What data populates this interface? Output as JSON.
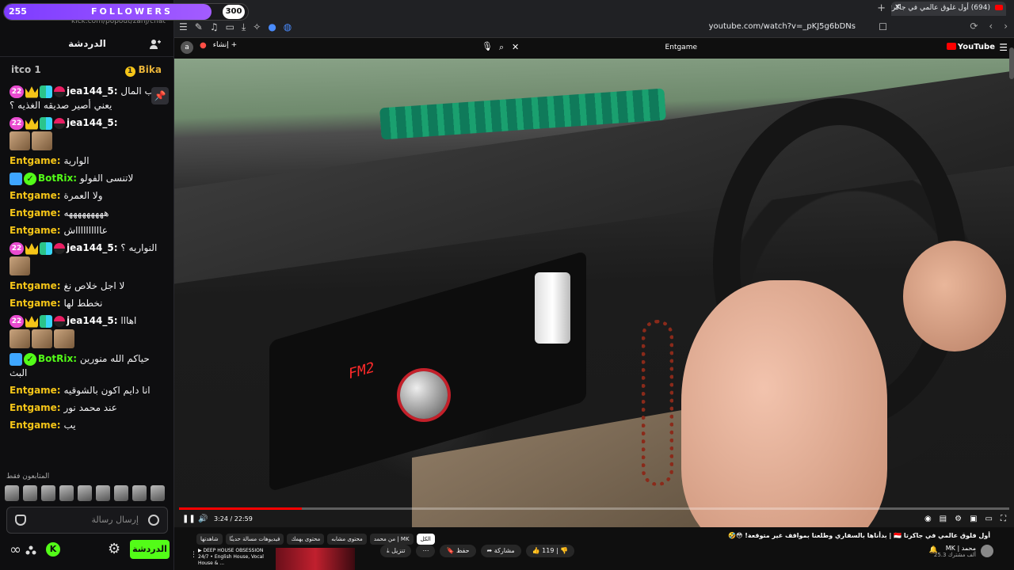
{
  "followers": {
    "current": "255",
    "label": "FOLLOWERS",
    "goal": "300",
    "progress_fraction": 0.85
  },
  "kick_url": "kick.com/popout/zanj/chat",
  "chat": {
    "title": "الدردشة",
    "top_left": "itco 1",
    "top_right": "Bika",
    "messages": [
      {
        "name": "jea144_5:",
        "name_color": "#ffffff",
        "badges": [
          "sub22",
          "crown",
          "grid",
          "pokeball"
        ],
        "text": "ب المال يعني أصير صديقه الغذيه ؟",
        "emotes": 0
      },
      {
        "name": "jea144_5:",
        "name_color": "#ffffff",
        "badges": [
          "sub22",
          "crown",
          "grid",
          "pokeball"
        ],
        "text": "",
        "emotes": 2
      },
      {
        "name": "Entgame:",
        "name_color": "#f5c518",
        "badges": [],
        "text": "الوارية",
        "emotes": 0
      },
      {
        "name": "BotRix:",
        "name_color": "#53fc18",
        "badges": [
          "bot",
          "verified"
        ],
        "text": "لاتنسى الفولو",
        "emotes": 0
      },
      {
        "name": "Entgame:",
        "name_color": "#f5c518",
        "badges": [],
        "text": "ولا العمرة",
        "emotes": 0
      },
      {
        "name": "Entgame:",
        "name_color": "#f5c518",
        "badges": [],
        "text": "هههههههههه",
        "emotes": 0
      },
      {
        "name": "Entgame:",
        "name_color": "#f5c518",
        "badges": [],
        "text": "عااااااااااش",
        "emotes": 0
      },
      {
        "name": "jea144_5:",
        "name_color": "#ffffff",
        "badges": [
          "sub22",
          "crown",
          "grid",
          "pokeball"
        ],
        "text": "النواريه ؟",
        "emotes": 1
      },
      {
        "name": "Entgame:",
        "name_color": "#f5c518",
        "badges": [],
        "text": "لا اجل خلاص نغ",
        "emotes": 0
      },
      {
        "name": "Entgame:",
        "name_color": "#f5c518",
        "badges": [],
        "text": "نخطط لها",
        "emotes": 0
      },
      {
        "name": "jea144_5:",
        "name_color": "#ffffff",
        "badges": [
          "sub22",
          "crown",
          "grid",
          "pokeball"
        ],
        "text": "اهااا",
        "emotes": 3
      },
      {
        "name": "BotRix:",
        "name_color": "#53fc18",
        "badges": [
          "bot",
          "verified"
        ],
        "text": "حياكم الله منورين البث",
        "emotes": 0
      },
      {
        "name": "Entgame:",
        "name_color": "#f5c518",
        "badges": [],
        "text": "انا دايم اكون بالشوقيه",
        "emotes": 0
      },
      {
        "name": "Entgame:",
        "name_color": "#f5c518",
        "badges": [],
        "text": "عند محمد نور",
        "emotes": 0
      },
      {
        "name": "Entgame:",
        "name_color": "#f5c518",
        "badges": [],
        "text": "يب",
        "emotes": 0
      }
    ],
    "followers_only": "المتابعون فقط",
    "input_placeholder": "إرسال رسالة",
    "send_label": "الدردشة"
  },
  "browser": {
    "tab_title": "(694) أول غلوق عالمي في جاكرتا",
    "url": "youtube.com/watch?v=_pKJ5g6bDNs",
    "search_query": "Entgame",
    "youtube_label": "YouTube",
    "create_label": "إنشاء"
  },
  "player": {
    "time": "3:24 / 22:59",
    "progress_fraction": 0.148
  },
  "video_info": {
    "title": "أول فلوق عالمي في جاكرتا 🇮🇩 | بدأناها بالسفاري وطلعنا بمواقف غير متوقعة! 😳🤣",
    "channel": "MK | محمد",
    "subs": "25.3 ألف مشترك",
    "likes": "119",
    "share": "مشاركة",
    "download": "تنزيل",
    "save": "حفظ",
    "chips": [
      "الكل",
      "من محمد | MK",
      "محتوى مشابه",
      "محتوى يهمك",
      "فيديوهات مسالة حديثًا",
      "شاهدتها"
    ],
    "rec_title": "▶ DEEP HOUSE OBSESSION 24/7 • English House, Vocal House & ..."
  },
  "lcd_text": "FM2"
}
